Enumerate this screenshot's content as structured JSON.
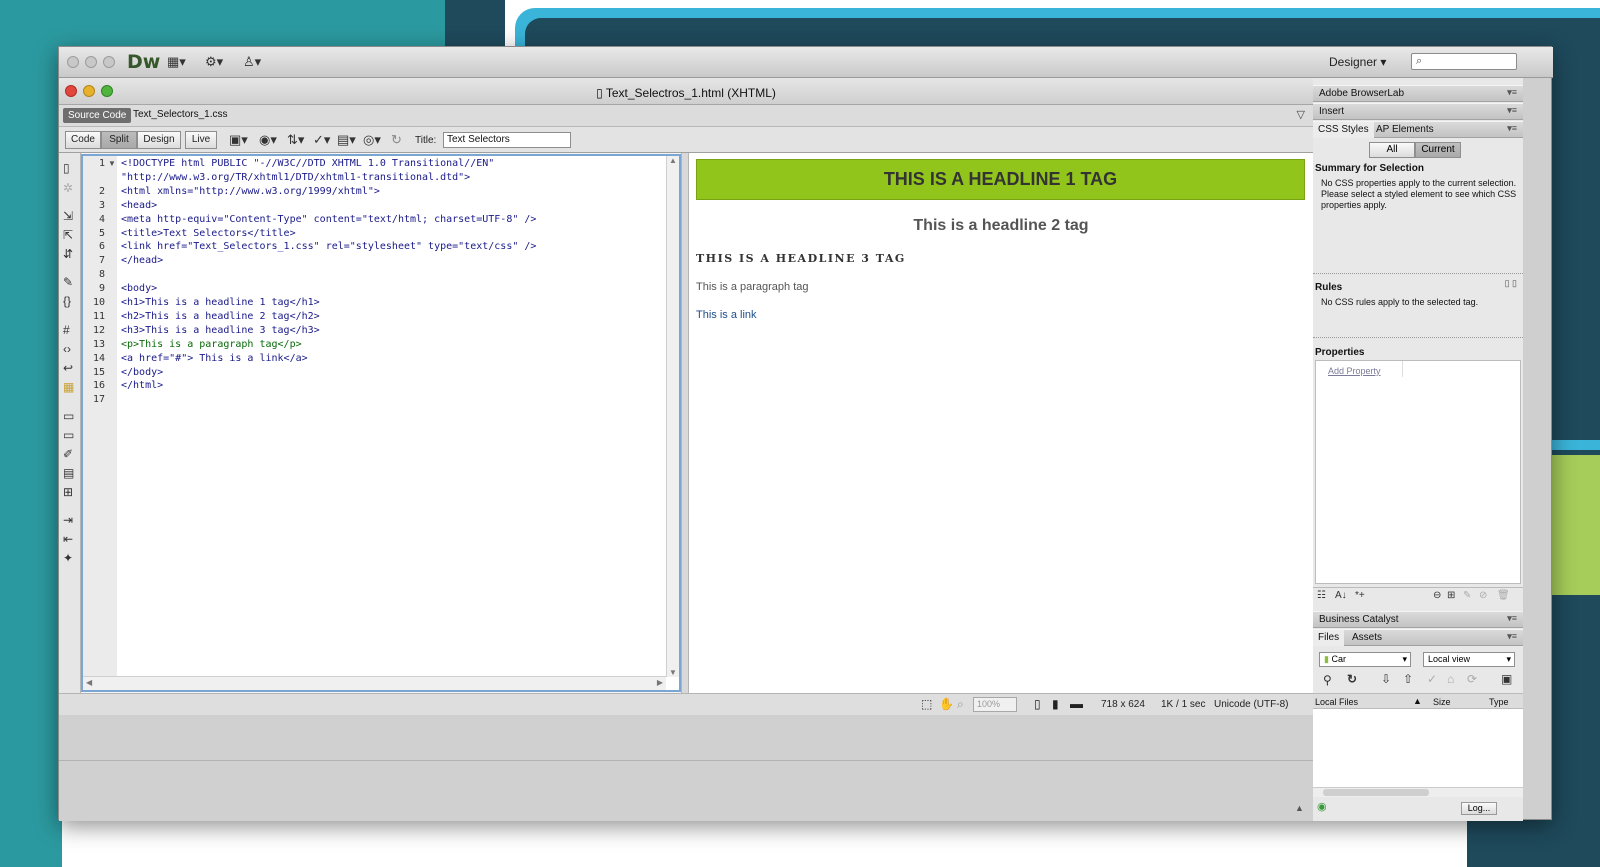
{
  "colors": {
    "headline1_bg": "#92c51b",
    "desktop_teal": "#2b9aa0",
    "desktop_navy": "#1e4a5c",
    "desktop_lightblue": "#3ab4d9",
    "desktop_green": "#a6cd5a"
  },
  "app": {
    "logo": "Dw",
    "workspace": "Designer",
    "toolbar_icons": [
      "layout-icon",
      "gear-icon",
      "site-icon"
    ]
  },
  "document": {
    "title": "Text_Selectros_1.html (XHTML)",
    "related_files": {
      "source": "Source Code",
      "css": "Text_Selectors_1.css"
    },
    "views": {
      "code": "Code",
      "split": "Split",
      "design": "Design",
      "live": "Live",
      "active": "Split"
    },
    "title_label": "Title:",
    "title_value": "Text Selectors"
  },
  "code": {
    "lines": [
      {
        "n": "1",
        "text": "<!DOCTYPE html PUBLIC \"-//W3C//DTD XHTML 1.0 Transitional//EN\""
      },
      {
        "n": "",
        "text": "\"http://www.w3.org/TR/xhtml1/DTD/xhtml1-transitional.dtd\">"
      },
      {
        "n": "2",
        "text": "<html xmlns=\"http://www.w3.org/1999/xhtml\">"
      },
      {
        "n": "3",
        "text": "<head>"
      },
      {
        "n": "4",
        "text": "<meta http-equiv=\"Content-Type\" content=\"text/html; charset=UTF-8\" />"
      },
      {
        "n": "5",
        "text": "<title>Text Selectors</title>"
      },
      {
        "n": "6",
        "text": "<link href=\"Text_Selectors_1.css\" rel=\"stylesheet\" type=\"text/css\" />"
      },
      {
        "n": "7",
        "text": "</head>"
      },
      {
        "n": "8",
        "text": ""
      },
      {
        "n": "9",
        "text": "<body>"
      },
      {
        "n": "10",
        "text": "<h1>This is a headline 1 tag</h1>"
      },
      {
        "n": "11",
        "text": "<h2>This is a headline 2 tag</h2>"
      },
      {
        "n": "12",
        "text": "<h3>This is a headline 3 tag</h3>"
      },
      {
        "n": "13",
        "text": "<p>This is a paragraph tag</p>"
      },
      {
        "n": "14",
        "text": "<a href=\"#\"> This is a link</a>"
      },
      {
        "n": "15",
        "text": "</body>"
      },
      {
        "n": "16",
        "text": "</html>"
      },
      {
        "n": "17",
        "text": ""
      }
    ]
  },
  "design": {
    "h1": "THIS IS A HEADLINE 1 TAG",
    "h2": "This is a headline 2 tag",
    "h3": "THIS IS A HEADLINE 3 TAG",
    "p": "This is a paragraph tag",
    "link": "This is a link"
  },
  "status": {
    "zoom": "100%",
    "size": "718 x 624",
    "download": "1K / 1 sec",
    "encoding": "Unicode (UTF-8)"
  },
  "panels": {
    "browserlab": "Adobe BrowserLab",
    "insert": "Insert",
    "css_tab": "CSS Styles",
    "ap_tab": "AP Elements",
    "all": "All",
    "current": "Current",
    "summary_title": "Summary for Selection",
    "summary_text": "No CSS properties apply to the current selection.  Please select a styled element to see which CSS properties apply.",
    "rules_title": "Rules",
    "rules_text": "No CSS rules apply to the selected tag.",
    "properties_title": "Properties",
    "add_property": "Add Property",
    "business_catalyst": "Business Catalyst",
    "files_tab": "Files",
    "assets_tab": "Assets",
    "site": "Car",
    "view": "Local view",
    "col_local": "Local Files",
    "col_size": "Size",
    "col_type": "Type",
    "log": "Log..."
  }
}
